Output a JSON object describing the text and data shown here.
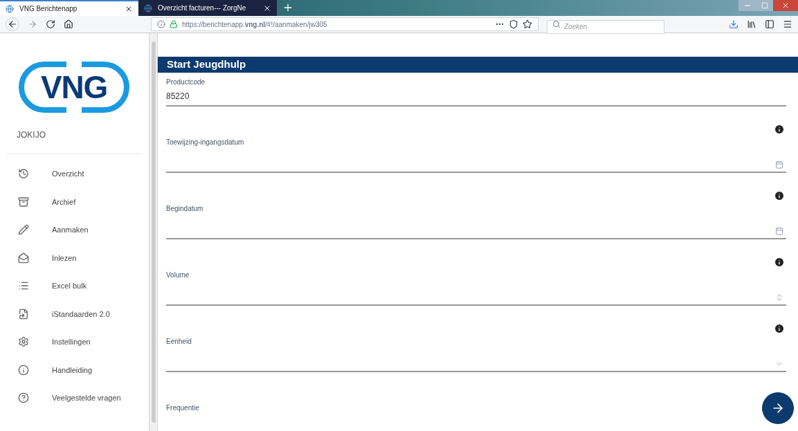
{
  "browser": {
    "tabs": [
      {
        "label": "VNG Berichtenapp",
        "selected": true
      },
      {
        "label": "Overzicht facturen--- ZorgNe",
        "selected": false
      }
    ],
    "url": "https://berichtenapp.**vng.nl**/#!/aanmaken/jw305",
    "search": {
      "placeholder": "Zoeken"
    }
  },
  "sidebar": {
    "logo": "VNG",
    "user": "JOKIJO",
    "items": [
      {
        "label": "Overzicht",
        "kind": "history"
      },
      {
        "label": "Archief",
        "kind": "archive"
      },
      {
        "label": "Aanmaken",
        "kind": "pencil"
      },
      {
        "label": "Inlezen",
        "kind": "mail"
      },
      {
        "label": "Excel bulk",
        "kind": "list"
      },
      {
        "label": "iStandaarden 2.0",
        "kind": "file"
      },
      {
        "label": "Instellingen",
        "kind": "gear"
      },
      {
        "label": "Handleiding",
        "kind": "info"
      },
      {
        "label": "Veelgestelde vragen",
        "kind": "help"
      }
    ]
  },
  "form": {
    "title": "Start Jeugdhulp",
    "fields": [
      {
        "label": "Productcode",
        "value": "85220",
        "kind": "text",
        "info": false
      },
      {
        "label": "Toewijzing-ingangsdatum",
        "kind": "date",
        "info": true
      },
      {
        "label": "Begindatum",
        "kind": "date",
        "info": true
      },
      {
        "label": "Volume",
        "kind": "number",
        "info": true
      },
      {
        "label": "Eenheid",
        "kind": "select",
        "info": true
      },
      {
        "label": "Frequentie",
        "kind": "partial",
        "info": false
      }
    ]
  }
}
